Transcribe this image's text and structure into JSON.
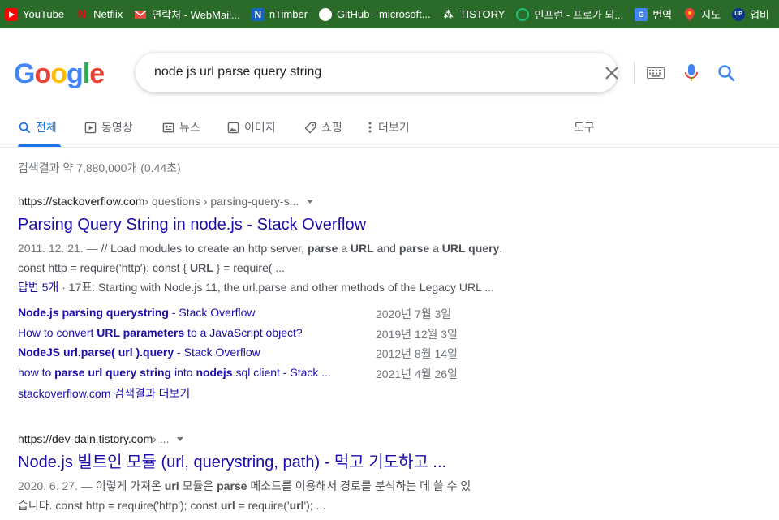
{
  "bookmarks": [
    {
      "label": "YouTube",
      "icon": "youtube-icon",
      "color": "#ff0000"
    },
    {
      "label": "Netflix",
      "icon": "netflix-icon",
      "color": "#e50914"
    },
    {
      "label": "연락처 - WebMail...",
      "icon": "mail-icon",
      "color": "#e64a3c"
    },
    {
      "label": "nTimber",
      "icon": "ntimber-icon",
      "color": "#1565c0"
    },
    {
      "label": "GitHub - microsoft...",
      "icon": "github-icon",
      "color": "#ffffff"
    },
    {
      "label": "TISTORY",
      "icon": "tistory-icon",
      "color": "#222222"
    },
    {
      "label": "인프런 - 프로가 되...",
      "icon": "inflearn-icon",
      "color": "#1dc078"
    },
    {
      "label": "번역",
      "icon": "translate-icon",
      "color": "#4285f4"
    },
    {
      "label": "지도",
      "icon": "maps-icon",
      "color": "#34a853"
    },
    {
      "label": "업비",
      "icon": "upbit-icon",
      "color": "#093687"
    }
  ],
  "logo": {
    "letters": [
      "G",
      "o",
      "o",
      "g",
      "l",
      "e"
    ],
    "colors": [
      "#4285f4",
      "#ea4335",
      "#fbbc05",
      "#4285f4",
      "#34a853",
      "#ea4335"
    ]
  },
  "search": {
    "query": "node js url parse query string"
  },
  "tabs": [
    {
      "label": "전체",
      "icon": "search-icon",
      "active": true
    },
    {
      "label": "동영상",
      "icon": "video-icon"
    },
    {
      "label": "뉴스",
      "icon": "news-icon"
    },
    {
      "label": "이미지",
      "icon": "image-icon"
    },
    {
      "label": "쇼핑",
      "icon": "tag-icon"
    },
    {
      "label": "더보기",
      "icon": "more-vert-icon"
    }
  ],
  "tools_label": "도구",
  "stats": "검색결과 약 7,880,000개 (0.44초)",
  "results": [
    {
      "cite_domain": "https://stackoverflow.com",
      "cite_path": " › questions › parsing-query-s...",
      "title": "Parsing Query String in node.js - Stack Overflow",
      "snippet_date": "2011. 12. 21. — ",
      "snippet_parts": [
        {
          "t": "// Load modules to create an http server, ",
          "b": false
        },
        {
          "t": "parse",
          "b": true
        },
        {
          "t": " a ",
          "b": false
        },
        {
          "t": "URL",
          "b": true
        },
        {
          "t": " and ",
          "b": false
        },
        {
          "t": "parse",
          "b": true
        },
        {
          "t": " a ",
          "b": false
        },
        {
          "t": "URL query",
          "b": true
        },
        {
          "t": ".",
          "b": false
        }
      ],
      "snippet_line2_parts": [
        {
          "t": "const http = require('http'); const { ",
          "b": false
        },
        {
          "t": "URL",
          "b": true
        },
        {
          "t": " } = require( ...",
          "b": false
        }
      ],
      "answers_link": "답변 5개",
      "answers_meta": " · 17표: Starting with Node.js 11, the url.parse and other methods of the Legacy URL ...",
      "sitelinks": [
        {
          "parts": [
            {
              "t": "Node.js parsing querystring",
              "b": true
            },
            {
              "t": " - Stack Overflow",
              "b": false
            }
          ],
          "date": "2020년 7월 3일"
        },
        {
          "parts": [
            {
              "t": "How to convert ",
              "b": false
            },
            {
              "t": "URL parameters",
              "b": true
            },
            {
              "t": " to a JavaScript object?",
              "b": false
            }
          ],
          "date": "2019년 12월 3일"
        },
        {
          "parts": [
            {
              "t": "NodeJS url.parse( url ).query",
              "b": true
            },
            {
              "t": " - Stack Overflow",
              "b": false
            }
          ],
          "date": "2012년 8월 14일"
        },
        {
          "parts": [
            {
              "t": "how to ",
              "b": false
            },
            {
              "t": "parse url query string",
              "b": true
            },
            {
              "t": " into ",
              "b": false
            },
            {
              "t": "nodejs",
              "b": true
            },
            {
              "t": " sql client - Stack ...",
              "b": false
            }
          ],
          "date": "2021년 4월 26일"
        }
      ],
      "more_link": "stackoverflow.com 검색결과 더보기"
    },
    {
      "cite_domain": "https://dev-dain.tistory.com",
      "cite_path": " › ...",
      "title": "Node.js 빌트인 모듈 (url, querystring, path) - 먹고 기도하고 ...",
      "snippet_date": "2020. 6. 27. — ",
      "snippet_parts": [
        {
          "t": "이렇게 가져온 ",
          "b": false
        },
        {
          "t": "url",
          "b": true
        },
        {
          "t": " 모듈은 ",
          "b": false
        },
        {
          "t": "parse",
          "b": true
        },
        {
          "t": " 메소드를 이용해서 경로를 분석하는 데 쓸 수 있",
          "b": false
        }
      ],
      "snippet_line2_parts": [
        {
          "t": "습니다. const http = require('http'); const ",
          "b": false
        },
        {
          "t": "url",
          "b": true
        },
        {
          "t": " = require('",
          "b": false
        },
        {
          "t": "url",
          "b": true
        },
        {
          "t": "'); ...",
          "b": false
        }
      ]
    }
  ]
}
